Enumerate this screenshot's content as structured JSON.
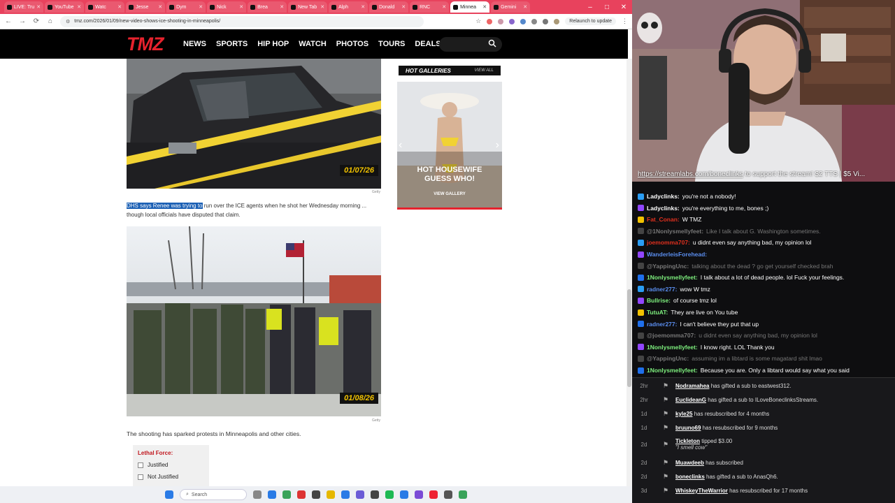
{
  "browser": {
    "tabs": [
      "LIVE: Tru",
      "YouTube",
      "Watc",
      "Jesse",
      "Dym",
      "Nick",
      "Brea",
      "New Tab",
      "Alph",
      "Donald",
      "RNC",
      "Minnea",
      "Gemini"
    ],
    "url": "tmz.com/2026/01/09/new-video-shows-ice-shooting-in-minneapolis/",
    "relaunch": "Relaunch to update"
  },
  "tmz": {
    "logo": "TMZ",
    "nav": [
      "NEWS",
      "SPORTS",
      "HIP HOP",
      "WATCH",
      "PHOTOS",
      "TOURS",
      "DEALS"
    ],
    "photo1_date": "01/07/26",
    "photo2_date": "01/08/26",
    "credit": "Getty",
    "para_highlight": "DHS says Renee was trying to",
    "para_rest": " run over the ICE agents when he shot her Wednesday morning ... though local officials have disputed that claim.",
    "para2": "The shooting has sparked protests in Minneapolis and other cities.",
    "poll": {
      "title": "Lethal Force:",
      "options": [
        "Justified",
        "Not Justified"
      ]
    },
    "hot_galleries": {
      "header": "HOT GALLERIES",
      "view_all": "VIEW ALL",
      "caption_line1": "HOT HOUSEWIFE",
      "caption_line2": "GUESS WHO!",
      "view_gallery": "VIEW GALLERY"
    }
  },
  "taskbar": {
    "search": "Search"
  },
  "stream": {
    "url_link": "https://streamlabs.com/boneclinks",
    "url_rest": " to support the stream! $2 TTS | $5 Vi..."
  },
  "chat": [
    {
      "user": "Ladyclinks:",
      "text": "you're not a nobody!",
      "color": "#ffffff",
      "faded": false
    },
    {
      "user": "Ladyclinks:",
      "text": "you're everything to me, bones ;)",
      "color": "#ffffff",
      "faded": false
    },
    {
      "user": "Fat_Conan:",
      "text": "W TMZ",
      "color": "#e0301e",
      "faded": false
    },
    {
      "user": "@1Nonlysmellyfeet:",
      "text": "Like I talk about G. Washington sometimes.",
      "color": "#777777",
      "faded": true
    },
    {
      "user": "joemomma707:",
      "text": "u didnt even say anything bad, my opinion lol",
      "color": "#e0301e",
      "faded": false
    },
    {
      "user": "WanderleisForehead:",
      "text": "",
      "color": "#5a8dee",
      "faded": false
    },
    {
      "user": "@YappingUnc:",
      "text": "talking about the dead ? go get yourself checked brah",
      "color": "#777777",
      "faded": true
    },
    {
      "user": "1Nonlysmellyfeet:",
      "text": "I talk about a lot of dead people. lol Fuck your feelings.",
      "color": "#7ef07e",
      "faded": false
    },
    {
      "user": "radner277:",
      "text": "wow W tmz",
      "color": "#5a8dee",
      "faded": false
    },
    {
      "user": "Bullrise:",
      "text": "of course tmz lol",
      "color": "#7ef07e",
      "faded": false
    },
    {
      "user": "TutuAT:",
      "text": "They are live on You tube",
      "color": "#7ef07e",
      "faded": false
    },
    {
      "user": "radner277:",
      "text": "I can't believe they put that up",
      "color": "#5a8dee",
      "faded": false
    },
    {
      "user": "@joemomma707:",
      "text": "u didnt even say anything bad, my opinion lol",
      "color": "#777777",
      "faded": true
    },
    {
      "user": "1Nonlysmellyfeet:",
      "text": "I know right. LOL Thank you",
      "color": "#7ef07e",
      "faded": false
    },
    {
      "user": "@YappingUnc:",
      "text": "assuming im a libtard is some magatard shit lmao",
      "color": "#777777",
      "faded": true
    },
    {
      "user": "1Nonlysmellyfeet:",
      "text": "Because you are. Only a libtard would say what you said",
      "color": "#7ef07e",
      "faded": false
    }
  ],
  "alerts": [
    {
      "time": "2hr",
      "name": "Nodramahea",
      "action": " has gifted a sub to eastwest312."
    },
    {
      "time": "2hr",
      "name": "EuclideanG",
      "action": " has gifted a sub to ILoveBoneclinksStreams."
    },
    {
      "time": "1d",
      "name": "kyle25",
      "action": " has resubscribed for 4 months"
    },
    {
      "time": "1d",
      "name": "bruuno69",
      "action": " has resubscribed for 9 months"
    },
    {
      "time": "2d",
      "name": "Tickleton",
      "action": " tipped $3.00",
      "note": "\"I smell cow\""
    },
    {
      "time": "2d",
      "name": "Muawdeeb",
      "action": " has subscribed"
    },
    {
      "time": "2d",
      "name": "boneclinks",
      "action": " has gifted a sub to AnasQh6."
    },
    {
      "time": "3d",
      "name": "WhiskeyTheWarrior",
      "action": " has resubscribed for 17 months"
    }
  ]
}
